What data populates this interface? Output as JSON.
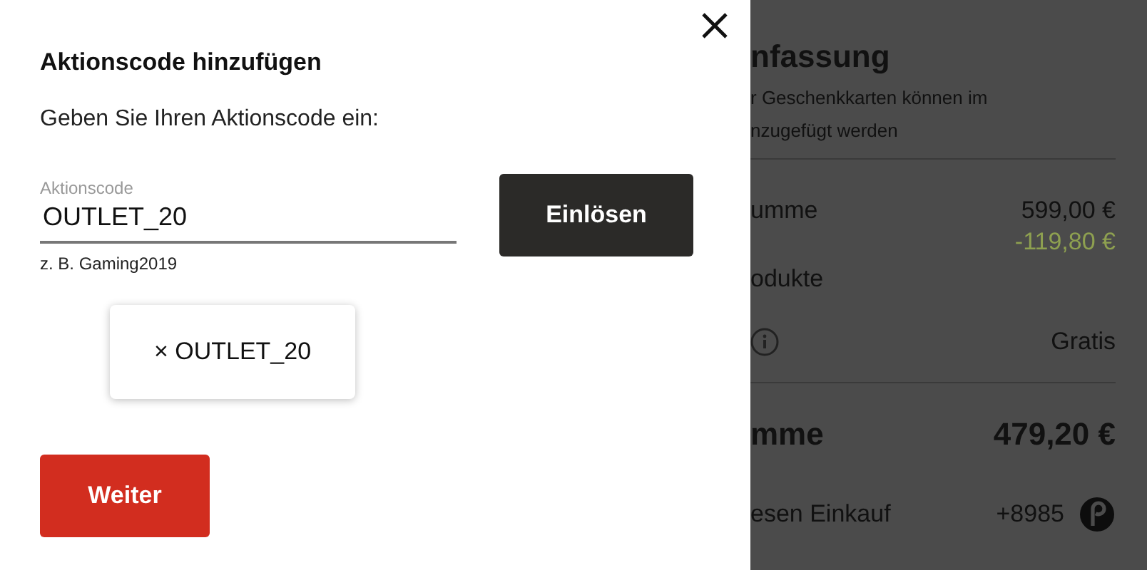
{
  "dialog": {
    "title": "Aktionscode hinzufügen",
    "prompt": "Geben Sie Ihren Aktionscode ein:",
    "field": {
      "label": "Aktionscode",
      "value": "OUTLET_20",
      "hint": "z. B. Gaming2019"
    },
    "redeem_button": "Einlösen",
    "applied_codes": [
      {
        "label": "× OUTLET_20"
      }
    ],
    "continue_button": "Weiter"
  },
  "summary": {
    "title": "nfassung",
    "note_lines": [
      "r Geschenkkarten können im",
      "nzugefügt werden"
    ],
    "rows": [
      {
        "kind": "subtotal",
        "label": "umme",
        "value": "599,00 €",
        "discount": "-119,80 €"
      },
      {
        "kind": "plain",
        "label": "odukte"
      },
      {
        "kind": "info",
        "value": "Gratis"
      },
      {
        "kind": "divider"
      },
      {
        "kind": "total",
        "label": "mme",
        "value": "479,20 €"
      },
      {
        "kind": "points",
        "label": "esen Einkauf",
        "value": "+8985"
      }
    ]
  }
}
